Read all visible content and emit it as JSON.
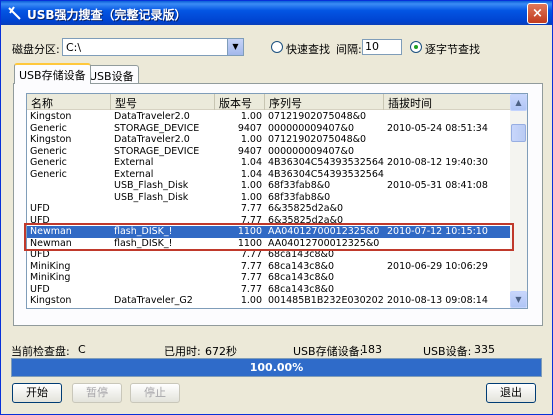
{
  "window": {
    "title": "USB强力搜查（完整记录版）"
  },
  "controls": {
    "partition_label": "磁盘分区:",
    "partition_value": "C:\\",
    "quick_search_label": "快速查找",
    "interval_label": "间隔:",
    "interval_value": "10",
    "byte_search_label": "逐字节查找",
    "selected_mode": "byte"
  },
  "tabs": [
    {
      "label": "USB存储设备",
      "active": true
    },
    {
      "label": "USB设备",
      "active": false
    }
  ],
  "table": {
    "columns": [
      "名称",
      "型号",
      "版本号",
      "序列号",
      "插拔时间"
    ],
    "rows": [
      [
        "Kingston",
        "DataTraveler2.0",
        "1.00",
        "07121902075048&0",
        ""
      ],
      [
        "Generic",
        "STORAGE_DEVICE",
        "9407",
        "000000009407&0",
        "2010-05-24 08:51:34"
      ],
      [
        "Kingston",
        "DataTraveler2.0",
        "1.00",
        "07121902075048&0",
        ""
      ],
      [
        "Generic",
        "STORAGE_DEVICE",
        "9407",
        "000000009407&0",
        ""
      ],
      [
        "Generic",
        "External",
        "1.04",
        "4B36304C54393532564...",
        "2010-08-12 19:40:30"
      ],
      [
        "Generic",
        "External",
        "1.04",
        "4B36304C54393532564...",
        ""
      ],
      [
        "",
        "USB_Flash_Disk",
        "1.00",
        "68f33fab8&0",
        "2010-05-31 08:41:08"
      ],
      [
        "",
        "USB_Flash_Disk",
        "1.00",
        "68f33fab8&0",
        ""
      ],
      [
        "UFD",
        "",
        "7.77",
        "6&35825d2a&0",
        ""
      ],
      [
        "UFD",
        "",
        "7.77",
        "6&35825d2a&0",
        ""
      ],
      [
        "Newman",
        "flash_DISK_!",
        "1100",
        "AA04012700012325&0",
        "2010-07-12 10:15:10"
      ],
      [
        "Newman",
        "flash_DISK_!",
        "1100",
        "AA04012700012325&0",
        ""
      ],
      [
        "UFD",
        "",
        "7.77",
        "68ca143c8&0",
        ""
      ],
      [
        "MiniKing",
        "",
        "7.77",
        "68ca143c8&0",
        "2010-06-29 10:06:29"
      ],
      [
        "MiniKing",
        "",
        "7.77",
        "68ca143c8&0",
        ""
      ],
      [
        "UFD",
        "",
        "7.77",
        "68ca143c8&0",
        ""
      ],
      [
        "Kingston",
        "DataTraveler_G2",
        "1.00",
        "001485B1B232E030202...",
        "2010-08-13 09:08:14"
      ]
    ],
    "selected_row": 10
  },
  "status": {
    "current_disk_label": "当前检查盘:",
    "current_disk_value": "C",
    "elapsed_label": "已用时:",
    "elapsed_value": "672秒",
    "usb_storage_label": "USB存储设备:",
    "usb_storage_value": "183",
    "usb_device_label": "USB设备:",
    "usb_device_value": "335"
  },
  "progress": {
    "text": "100.00%",
    "fraction": 1.0
  },
  "buttons": {
    "start": "开始",
    "pause": "暂停",
    "stop": "停止",
    "exit": "退出"
  },
  "colors": {
    "accent": "#316ac5",
    "progress": "#2f6bc9",
    "highlight": "#c0392b"
  }
}
